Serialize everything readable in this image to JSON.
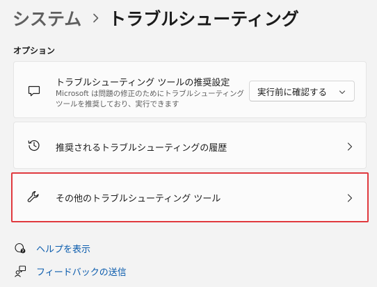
{
  "breadcrumb": {
    "parent": "システム",
    "separator_icon": "chevron-right-icon",
    "current": "トラブルシューティング"
  },
  "section": {
    "label": "オプション"
  },
  "cards": {
    "recommended_settings": {
      "icon": "chat-bubble-icon",
      "title": "トラブルシューティング ツールの推奨設定",
      "description_line1": "Microsoft は問題の修正のためにトラブルシューティング",
      "description_line2": "ツールを推奨しており、実行できます",
      "dropdown_value": "実行前に確認する",
      "dropdown_icon": "chevron-down-icon"
    },
    "history": {
      "icon": "history-icon",
      "title": "推奨されるトラブルシューティングの履歴",
      "chevron_icon": "chevron-right-icon"
    },
    "other_tools": {
      "icon": "wrench-icon",
      "title": "その他のトラブルシューティング ツール",
      "chevron_icon": "chevron-right-icon",
      "highlight_color": "#e0393e"
    }
  },
  "links": {
    "help": {
      "icon": "help-icon",
      "label": "ヘルプを表示"
    },
    "feedback": {
      "icon": "feedback-icon",
      "label": "フィードバックの送信"
    }
  },
  "colors": {
    "background": "#f3f3f3",
    "card": "#fbfbfb",
    "link": "#0b5cad",
    "highlight": "#e0393e"
  }
}
